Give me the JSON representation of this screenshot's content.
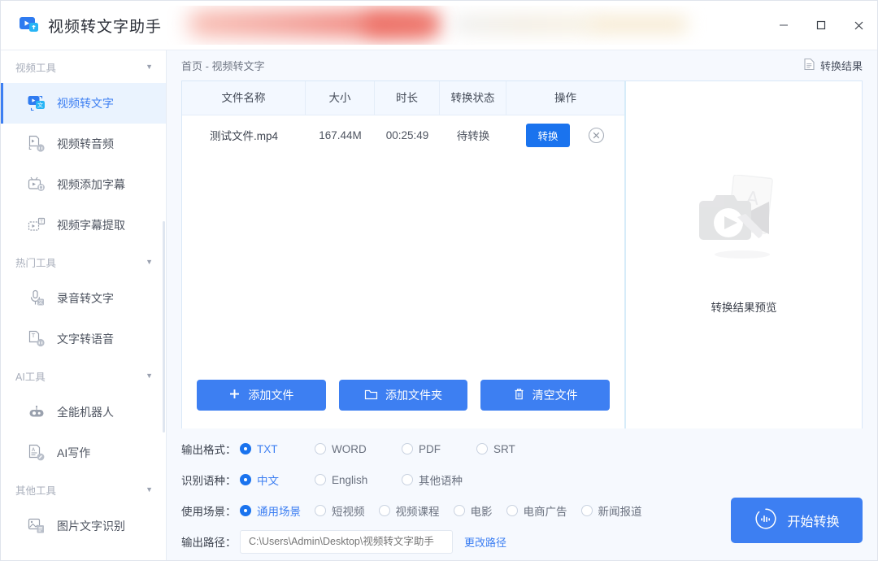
{
  "window": {
    "app_title": "视频转文字助手",
    "logo_icon": "video-to-text-logo-icon",
    "minimize_label": "最小化",
    "maximize_label": "最大化",
    "close_label": "关闭"
  },
  "sidebar": {
    "groups": [
      {
        "title": "视频工具",
        "caret_icon": "chevron-down-icon",
        "items": [
          {
            "label": "视频转文字",
            "icon": "video-to-text-icon",
            "active": true
          },
          {
            "label": "视频转音频",
            "icon": "video-to-audio-icon",
            "active": false
          },
          {
            "label": "视频添加字幕",
            "icon": "video-add-subtitle-icon",
            "active": false
          },
          {
            "label": "视频字幕提取",
            "icon": "video-subtitle-extract-icon",
            "active": false
          }
        ]
      },
      {
        "title": "热门工具",
        "caret_icon": "chevron-down-icon",
        "items": [
          {
            "label": "录音转文字",
            "icon": "microphone-to-text-icon",
            "active": false
          },
          {
            "label": "文字转语音",
            "icon": "text-to-speech-icon",
            "active": false
          }
        ]
      },
      {
        "title": "AI工具",
        "caret_icon": "chevron-down-icon",
        "items": [
          {
            "label": "全能机器人",
            "icon": "robot-icon",
            "active": false
          },
          {
            "label": "AI写作",
            "icon": "ai-writing-icon",
            "active": false
          }
        ]
      },
      {
        "title": "其他工具",
        "caret_icon": "chevron-down-icon",
        "items": [
          {
            "label": "图片文字识别",
            "icon": "image-ocr-icon",
            "active": false
          }
        ]
      }
    ]
  },
  "header": {
    "breadcrumb": "首页 - 视频转文字",
    "result_link": "转换结果",
    "result_icon": "document-icon"
  },
  "table": {
    "columns": [
      "文件名称",
      "大小",
      "时长",
      "转换状态",
      "操作"
    ],
    "rows": [
      {
        "name": "测试文件.mp4",
        "size": "167.44M",
        "duration": "00:25:49",
        "status": "待转换",
        "action_label": "转换",
        "delete_icon": "close-circle-icon"
      }
    ]
  },
  "actions": {
    "add_file": "添加文件",
    "add_file_icon": "plus-icon",
    "add_folder": "添加文件夹",
    "add_folder_icon": "folder-icon",
    "clear_files": "清空文件",
    "clear_files_icon": "trash-icon"
  },
  "preview": {
    "caption": "转换结果预览",
    "placeholder_icon": "video-document-placeholder-icon"
  },
  "options": {
    "format": {
      "label": "输出格式：",
      "choices": [
        "TXT",
        "WORD",
        "PDF",
        "SRT"
      ],
      "selected": "TXT"
    },
    "language": {
      "label": "识别语种：",
      "choices": [
        "中文",
        "English",
        "其他语种"
      ],
      "selected": "中文"
    },
    "scenario": {
      "label": "使用场景：",
      "choices": [
        "通用场景",
        "短视频",
        "视频课程",
        "电影",
        "电商广告",
        "新闻报道"
      ],
      "selected": "通用场景"
    },
    "path": {
      "label": "输出路径：",
      "placeholder": "C:\\Users\\Admin\\Desktop\\视频转文字助手",
      "value": "",
      "change_link": "更改路径"
    }
  },
  "start": {
    "label": "开始转换",
    "icon": "audio-waveform-circle-icon"
  },
  "colors": {
    "accent": "#3d7ff2",
    "accent_strong": "#1a73ee",
    "content_bg": "#f6f9fe",
    "active_item_bg": "#eaf3fe"
  }
}
